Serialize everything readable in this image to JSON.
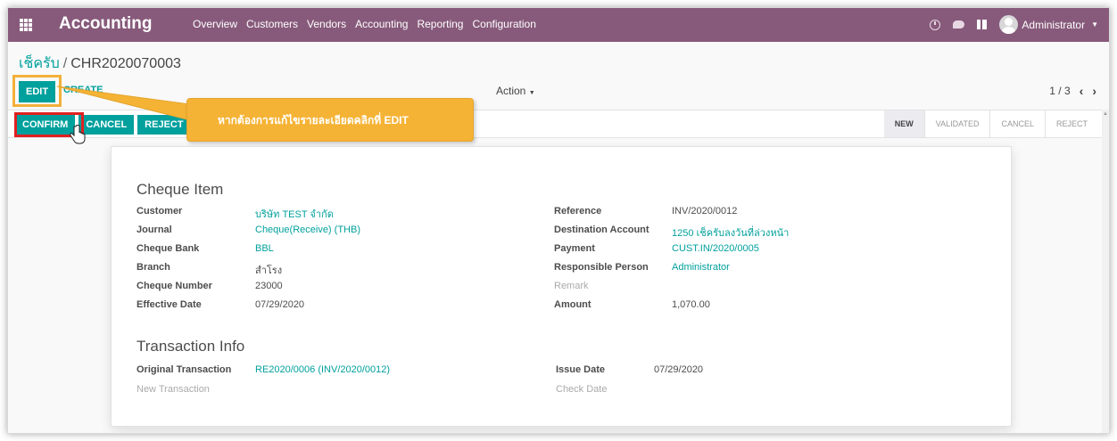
{
  "navbar": {
    "app_title": "Accounting",
    "menu": [
      "Overview",
      "Customers",
      "Vendors",
      "Accounting",
      "Reporting",
      "Configuration"
    ],
    "user": "Administrator",
    "color": "#875a7b"
  },
  "breadcrumb": {
    "parent": "เช็ครับ",
    "separator": "/",
    "current": "CHR2020070003"
  },
  "toolbar": {
    "edit_label": "EDIT",
    "create_label": "CREATE",
    "action_label": "Action"
  },
  "pager": {
    "value": "1 / 3"
  },
  "statusbar": {
    "buttons": [
      "CONFIRM",
      "CANCEL",
      "REJECT"
    ],
    "stages": [
      "NEW",
      "VALIDATED",
      "CANCEL",
      "REJECT"
    ],
    "active_stage": "NEW"
  },
  "tooltip": {
    "text": "หากต้องการแก้ไขรายละเอียดคลิกที่ EDIT"
  },
  "cheque_item": {
    "title": "Cheque Item",
    "left": [
      {
        "label": "Customer",
        "value": "บริษัท TEST จำกัด"
      },
      {
        "label": "Journal",
        "value": "Cheque(Receive) (THB)"
      },
      {
        "label": "Cheque Bank",
        "value": "BBL"
      },
      {
        "label": "Branch",
        "value": "สำโรง"
      },
      {
        "label": "Cheque Number",
        "value": "23000"
      },
      {
        "label": "Effective Date",
        "value": "07/29/2020"
      }
    ],
    "right": [
      {
        "label": "Reference",
        "value": "INV/2020/0012"
      },
      {
        "label": "Destination Account",
        "value": "1250 เช็ครับลงวันที่ล่วงหน้า"
      },
      {
        "label": "Payment",
        "value": "CUST.IN/2020/0005"
      },
      {
        "label": "Responsible Person",
        "value": "Administrator"
      },
      {
        "label": "Remark",
        "value": ""
      },
      {
        "label": "Amount",
        "value": "1,070.00"
      }
    ]
  },
  "transaction_info": {
    "title": "Transaction Info",
    "left": [
      {
        "label": "Original Transaction",
        "value": "RE2020/0006 (INV/2020/0012)"
      },
      {
        "label": "New Transaction",
        "value": ""
      }
    ],
    "right": [
      {
        "label": "Issue Date",
        "value": "07/29/2020"
      },
      {
        "label": "Check Date",
        "value": ""
      }
    ]
  },
  "colors": {
    "accent": "#00a09d",
    "highlight_red": "#e02020",
    "highlight_orange": "#f3b03a",
    "tooltip_bg": "#f5b335"
  }
}
